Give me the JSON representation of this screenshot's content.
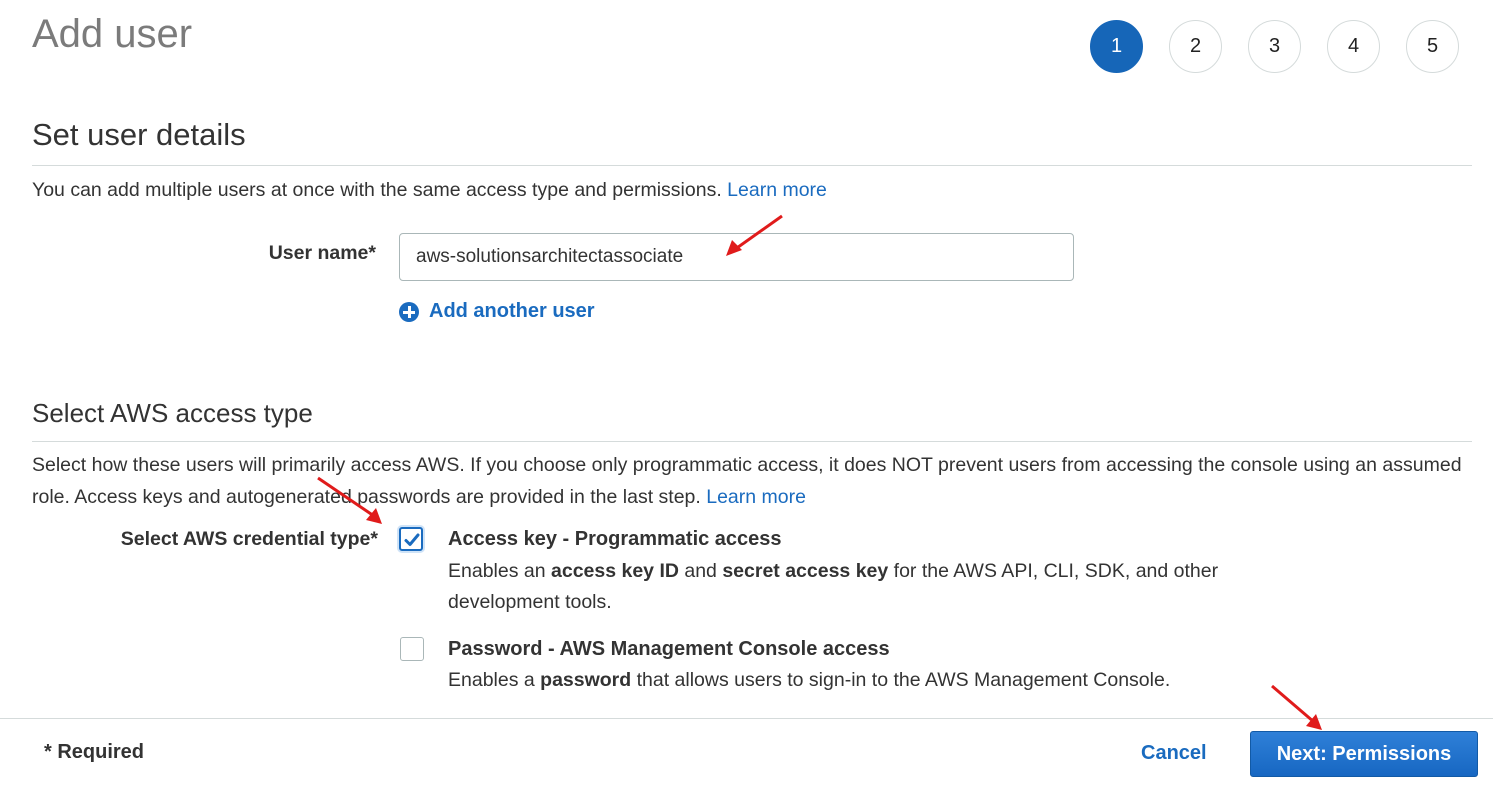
{
  "header": {
    "title": "Add user"
  },
  "steps": [
    {
      "label": "1",
      "active": true
    },
    {
      "label": "2",
      "active": false
    },
    {
      "label": "3",
      "active": false
    },
    {
      "label": "4",
      "active": false
    },
    {
      "label": "5",
      "active": false
    }
  ],
  "details": {
    "title": "Set user details",
    "description": "You can add multiple users at once with the same access type and permissions.",
    "learn_more": "Learn more",
    "username_label": "User name*",
    "username_value": "aws-solutionsarchitectassociate",
    "add_another_user": "Add another user"
  },
  "access": {
    "title": "Select AWS access type",
    "description": "Select how these users will primarily access AWS. If you choose only programmatic access, it does NOT prevent users from accessing the console using an assumed role. Access keys and autogenerated passwords are provided in the last step.",
    "learn_more": "Learn more",
    "credential_label": "Select AWS credential type*",
    "options": [
      {
        "title": "Access key - Programmatic access",
        "checked": true,
        "desc_1": "Enables an ",
        "desc_b1": "access key ID",
        "desc_2": " and ",
        "desc_b2": "secret access key",
        "desc_3": " for the AWS API, CLI, SDK, and other development tools."
      },
      {
        "title": "Password - AWS Management Console access",
        "checked": false,
        "desc_1": "Enables a ",
        "desc_b1": "password",
        "desc_2": " that allows users to sign-in to the AWS Management Console."
      }
    ]
  },
  "footer": {
    "required_note": "* Required",
    "cancel_label": "Cancel",
    "next_label": "Next: Permissions"
  },
  "colors": {
    "accent": "#1a6bbf",
    "step_active": "#1666b8",
    "annotation_arrow": "#e01b1b"
  }
}
